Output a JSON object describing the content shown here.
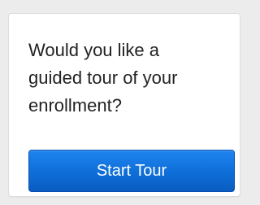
{
  "tour_prompt": {
    "line1": "Would you like a",
    "line2": "guided tour of your",
    "line3": "enrollment?",
    "button_label": "Start Tour"
  },
  "colors": {
    "page_background": "#ececec",
    "card_background": "#ffffff",
    "text": "#222222",
    "button_primary": "#0f6ed8"
  }
}
